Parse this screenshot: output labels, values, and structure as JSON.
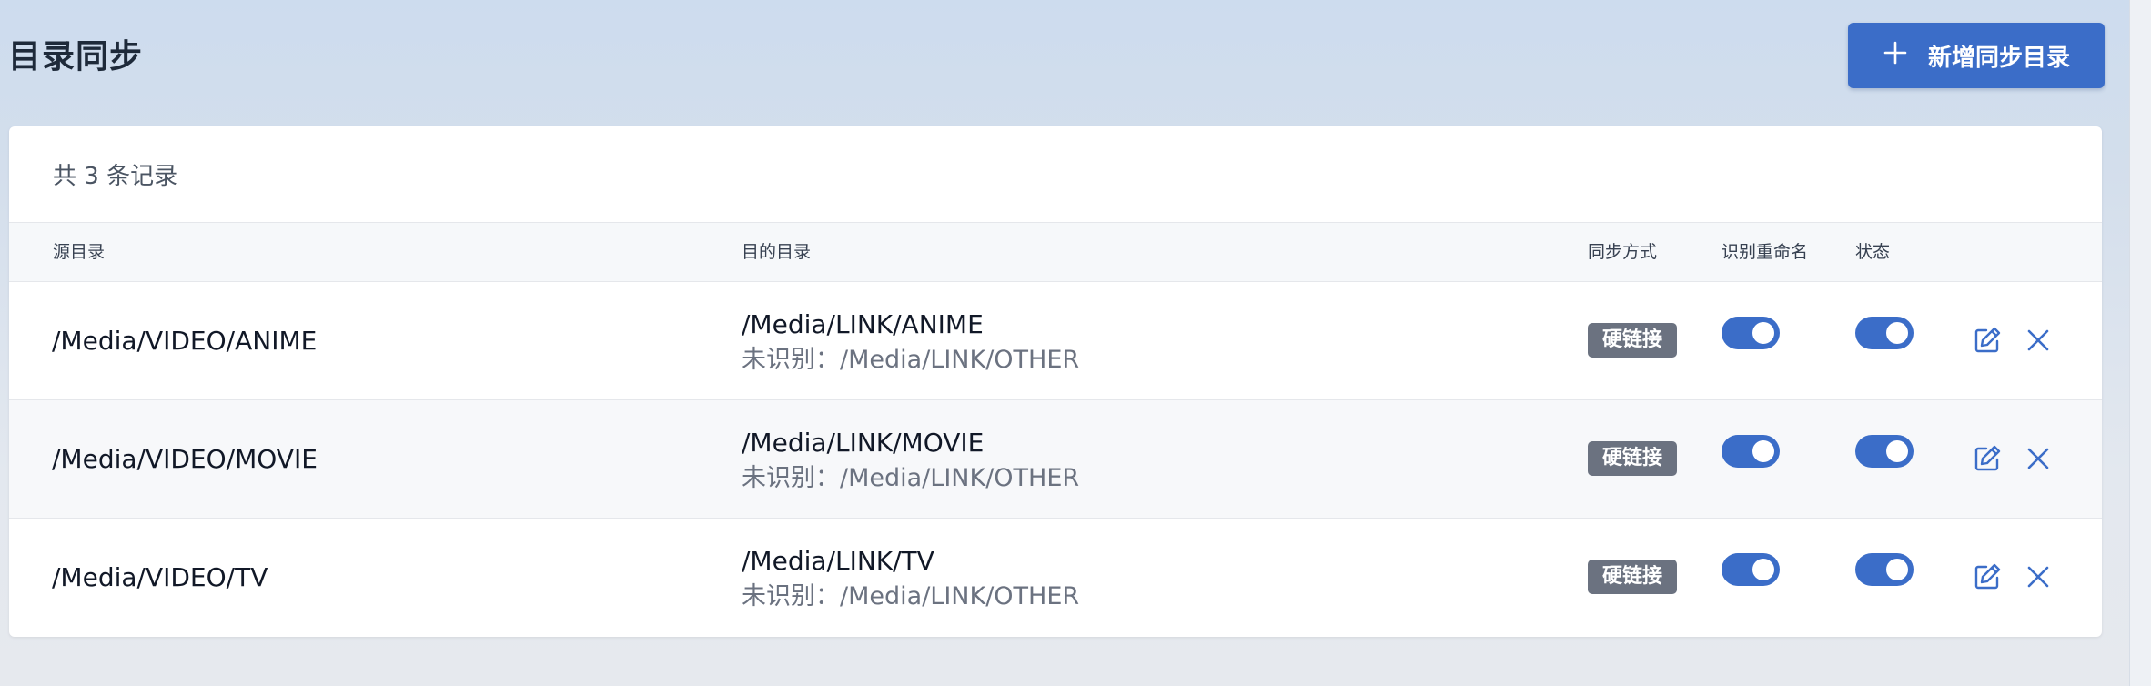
{
  "page": {
    "title": "目录同步"
  },
  "toolbar": {
    "add_label": "新增同步目录"
  },
  "card": {
    "record_count": "共 3 条记录"
  },
  "table": {
    "headers": {
      "source": "源目录",
      "target": "目的目录",
      "sync_mode": "同步方式",
      "rename": "识别重命名",
      "status": "状态"
    },
    "rows": [
      {
        "source": "/Media/VIDEO/ANIME",
        "target": "/Media/LINK/ANIME",
        "unrecognized": "未识别：/Media/LINK/OTHER",
        "mode": "硬链接",
        "rename": true,
        "status": true
      },
      {
        "source": "/Media/VIDEO/MOVIE",
        "target": "/Media/LINK/MOVIE",
        "unrecognized": "未识别：/Media/LINK/OTHER",
        "mode": "硬链接",
        "rename": true,
        "status": true
      },
      {
        "source": "/Media/VIDEO/TV",
        "target": "/Media/LINK/TV",
        "unrecognized": "未识别：/Media/LINK/OTHER",
        "mode": "硬链接",
        "rename": true,
        "status": true
      }
    ]
  },
  "colors": {
    "accent": "#3b6dc8",
    "badge": "#6b7280",
    "background": "#cddcee"
  },
  "icons": {
    "add": "plus-icon",
    "edit": "edit-icon",
    "delete": "close-icon"
  }
}
